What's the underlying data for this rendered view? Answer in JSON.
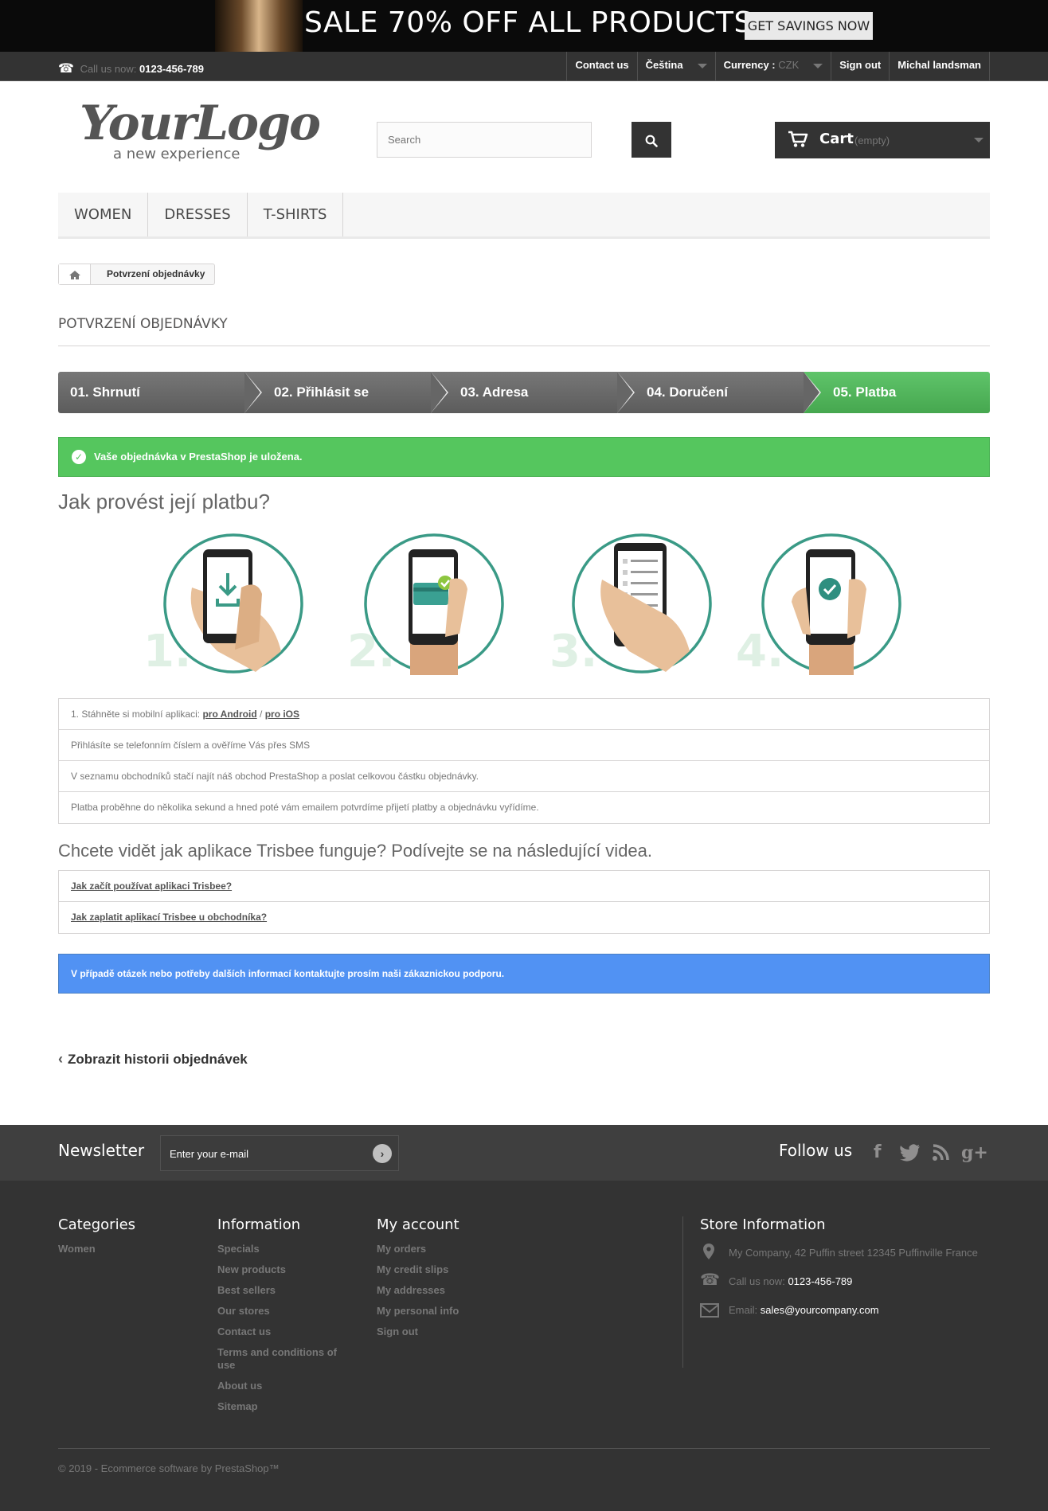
{
  "banner": {
    "sale": "SALE 70% OFF ALL PRODUCTS",
    "cta": "GET SAVINGS NOW"
  },
  "topbar": {
    "call_prefix": "Call us now:",
    "phone": "0123-456-789",
    "contact": "Contact us",
    "language": "Čeština",
    "currency_label": "Currency :",
    "currency_value": "CZK",
    "sign_out": "Sign out",
    "user": "Michal landsman"
  },
  "logo": {
    "main": "YourLogo",
    "tagline": "a new experience"
  },
  "search": {
    "placeholder": "Search"
  },
  "cart": {
    "label": "Cart",
    "status": "(empty)"
  },
  "menu": [
    "WOMEN",
    "DRESSES",
    "T-SHIRTS"
  ],
  "breadcrumb": {
    "current": "Potvrzení objednávky"
  },
  "page_title": "POTVRZENÍ OBJEDNÁVKY",
  "steps": [
    "01. Shrnutí",
    "02. Přihlásit se",
    "03. Adresa",
    "04. Doručení",
    "05. Platba"
  ],
  "success_message": "Vaše objednávka v PrestaShop je uložena.",
  "howto_title": "Jak provést její platbu?",
  "phone_steps": [
    "1.",
    "2.",
    "3.",
    "4."
  ],
  "instructions": {
    "row1_prefix": "1. Stáhněte si mobilní aplikaci:",
    "android": "pro Android",
    "sep": "/",
    "ios": "pro iOS",
    "row2": "Přihlásíte se telefonním číslem a ověříme Vás přes SMS",
    "row3": "V seznamu obchodníků stačí najít náš obchod PrestaShop a poslat celkovou částku objednávky.",
    "row4": "Platba proběhne do několika sekund a hned poté vám emailem potvrdíme přijetí platby a objednávku vyřídíme."
  },
  "videos": {
    "title": "Chcete vidět jak aplikace Trisbee funguje? Podívejte se na následující videa.",
    "link1": "Jak začít používat aplikaci Trisbee?",
    "link2": "Jak zaplatit aplikací Trisbee u obchodníka?"
  },
  "info_message": "V případě otázek nebo potřeby dalších informací kontaktujte prosím naši zákaznickou podporu.",
  "history_link": "Zobrazit historii objednávek",
  "newsletter": {
    "title": "Newsletter",
    "placeholder": "Enter your e-mail"
  },
  "follow": "Follow us",
  "footer": {
    "categories": {
      "title": "Categories",
      "items": [
        "Women"
      ]
    },
    "information": {
      "title": "Information",
      "items": [
        "Specials",
        "New products",
        "Best sellers",
        "Our stores",
        "Contact us",
        "Terms and conditions of use",
        "About us",
        "Sitemap"
      ]
    },
    "account": {
      "title": "My account",
      "items": [
        "My orders",
        "My credit slips",
        "My addresses",
        "My personal info",
        "Sign out"
      ]
    },
    "store": {
      "title": "Store Information",
      "address": "My Company, 42 Puffin street 12345 Puffinville France",
      "call_prefix": "Call us now:",
      "phone": "0123-456-789",
      "email_prefix": "Email:",
      "email": "sales@yourcompany.com"
    },
    "copyright": "© 2019 - Ecommerce software by PrestaShop™"
  }
}
